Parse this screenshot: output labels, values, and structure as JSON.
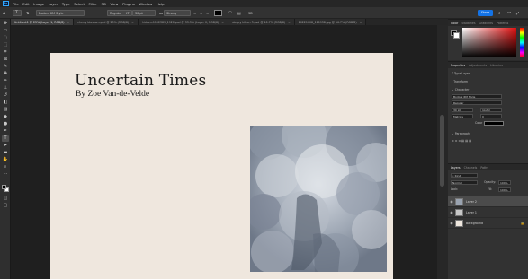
{
  "menu": {
    "logo": "Ps",
    "items": [
      "File",
      "Edit",
      "Image",
      "Layer",
      "Type",
      "Select",
      "Filter",
      "3D",
      "View",
      "Plugins",
      "Window",
      "Help"
    ]
  },
  "options_bar": {
    "font_family": "Bodoni 6M Style",
    "font_style": "Regular",
    "font_size": "30 pt",
    "anti_alias": "Strong",
    "share_label": "Share"
  },
  "tabs": [
    {
      "label": "Untitled-1 @ 25% (Layer 1, RGB/8)",
      "active": true
    },
    {
      "label": "cherry blossom.psd @ 25% (RGB/8)",
      "active": false
    },
    {
      "label": "hidden-1152389_1920.psd @ 33.3% (Layer 0, RGB/8)",
      "active": false
    },
    {
      "label": "sleepy kitten 3.psd @ 16.7% (RGB/8)",
      "active": false
    },
    {
      "label": "20221008_110938.jpg @ 16.7% (RGB/8)",
      "active": false
    }
  ],
  "document": {
    "title": "Uncertain Times",
    "byline": "By Zoe Van-de-Velde"
  },
  "panels": {
    "color": {
      "tabs": [
        "Color",
        "Swatches",
        "Gradients",
        "Patterns"
      ]
    },
    "properties": {
      "tabs": [
        "Properties",
        "Adjustments",
        "Libraries"
      ],
      "type_layer": "Type Layer",
      "transform": "Transform",
      "character": "Character",
      "font_family": "Bodoni 6M Style",
      "font_style": "Regular",
      "size": "30 pt",
      "leading": "(Auto)",
      "tracking": "0",
      "kerning": "Metrics",
      "color_label": "Color",
      "paragraph": "Paragraph"
    },
    "layers": {
      "tabs": [
        "Layers",
        "Channels",
        "Paths"
      ],
      "kind": "Kind",
      "blend_mode": "Normal",
      "opacity_label": "Opacity:",
      "opacity": "100%",
      "lock_label": "Lock:",
      "fill_label": "Fill:",
      "fill": "100%",
      "items": [
        {
          "name": "Layer 2",
          "selected": true
        },
        {
          "name": "Layer 1",
          "selected": false
        },
        {
          "name": "Background",
          "selected": false
        }
      ]
    }
  },
  "colors": {
    "accent": "#1473e6",
    "canvas_bg": "#efe7de",
    "ui_dark": "#323232"
  }
}
